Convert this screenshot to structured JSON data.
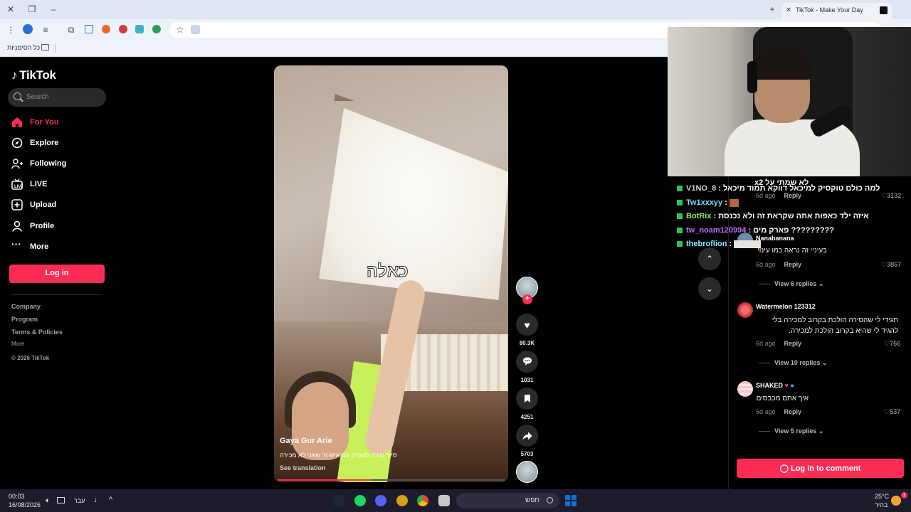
{
  "browser": {
    "tab_title": "TikTok - Make Your Day",
    "bookmarks_label": "כל הסימניות"
  },
  "nav": {
    "logo": "TikTok",
    "search_placeholder": "Search",
    "items": [
      {
        "label": "For You",
        "icon": "home-icon",
        "active": true
      },
      {
        "label": "Explore",
        "icon": "compass-icon"
      },
      {
        "label": "Following",
        "icon": "following-icon"
      },
      {
        "label": "LIVE",
        "icon": "live-icon"
      },
      {
        "label": "Upload",
        "icon": "upload-icon"
      },
      {
        "label": "Profile",
        "icon": "profile-icon"
      },
      {
        "label": "More",
        "icon": "more-icon"
      }
    ],
    "login": "Log in",
    "footer": [
      "Company",
      "Program",
      "Terms & Policies",
      "More",
      "© 2026 TikTok"
    ]
  },
  "video": {
    "overlay_text": "כאלה",
    "author": "Gaya Gur Arie",
    "caption": "סיור סירה מעמיק עם איש זר שאני לא מכירה",
    "see_translation": "See translation",
    "progress": 0.41
  },
  "actions": {
    "likes": "80.3K",
    "comments": "1031",
    "saves": "4251",
    "shares": "5703"
  },
  "comments": {
    "items": [
      {
        "date": "6d ago",
        "reply": "Reply",
        "likes": "3132"
      },
      {
        "user": "Nanabanana",
        "text": "בעיניי זה נראה כמו עינוי",
        "date": "6d ago",
        "reply": "Reply",
        "likes": "3857",
        "replies": "View 6 replies"
      },
      {
        "user": "Watermelon 123312",
        "text": "תגידי לי שהסירה הולכת בקרוב למכירה בלי להגיד לי שהיא בקרוב הולכת למכירה.",
        "date": "6d ago",
        "reply": "Reply",
        "likes": "766",
        "replies": "View 10 replies"
      },
      {
        "user": "SHAKED",
        "text": "איך אתם מכבסים",
        "date": "6d ago",
        "reply": "Reply",
        "likes": "537",
        "replies": "View 5 replies"
      }
    ],
    "login_button": "Log in to comment"
  },
  "chat": [
    {
      "user": "",
      "msg": "x2 לא שמתי על",
      "color": "#ffffff"
    },
    {
      "user": "V1NO_8",
      "msg": "למה כולם טוקסיק למיכאל דווקא תמוד מיכאל",
      "color": "#c8c8c8"
    },
    {
      "user": "Tw1xxxyy",
      "msg": "",
      "color": "#7ad7ff"
    },
    {
      "user": "BotRix",
      "msg": "איזה ילד כאפות אתה שקראת זה ולא נכנסת",
      "color": "#9be564"
    },
    {
      "user": "tw_noam120994",
      "msg": "פארק מים ?????????",
      "color": "#c36cff"
    },
    {
      "user": "thebroflion",
      "msg": "",
      "color": "#7df0ff"
    }
  ],
  "taskbar": {
    "time": "00:03",
    "date": "16/08/2026",
    "lang": "עבר",
    "search": "חפש",
    "weather_temp": "25°C",
    "weather_desc": "בהיר",
    "notif_count": "1"
  },
  "colors": {
    "accent": "#fe2c55"
  }
}
